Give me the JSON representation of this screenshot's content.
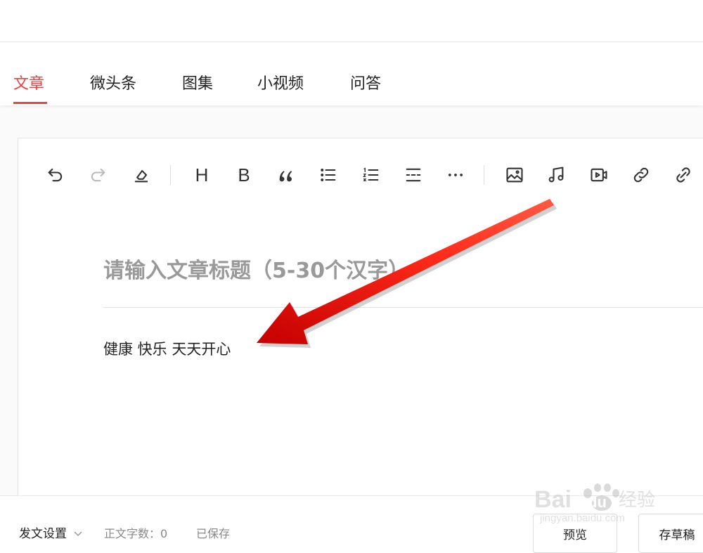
{
  "tabs": [
    {
      "label": "文章",
      "active": true
    },
    {
      "label": "微头条",
      "active": false
    },
    {
      "label": "图集",
      "active": false
    },
    {
      "label": "小视频",
      "active": false
    },
    {
      "label": "问答",
      "active": false
    }
  ],
  "toolbar": {
    "icons": [
      "undo-icon",
      "redo-icon",
      "clear-format-icon",
      "heading-icon",
      "bold-icon",
      "quote-icon",
      "bulleted-list-icon",
      "numbered-list-icon",
      "divider-icon",
      "more-icon",
      "image-icon",
      "music-icon",
      "video-icon",
      "link-icon",
      "insert-link-icon"
    ],
    "heading_label": "H",
    "bold_label": "B"
  },
  "editor": {
    "title_placeholder": "请输入文章标题（5-30个汉字）",
    "body_text": "健康 快乐 天天开心"
  },
  "footer": {
    "publish_settings": "发文设置",
    "word_count_label": "正文字数：0",
    "saved_status": "已保存",
    "preview_button": "预览",
    "draft_button": "存草稿"
  },
  "watermark": {
    "brand": "Bai",
    "brand_suffix": "du",
    "product": "经验",
    "url": "jingyan.baidu.com"
  },
  "colors": {
    "accent": "#f04142",
    "annotation_arrow": "#e8140f"
  }
}
